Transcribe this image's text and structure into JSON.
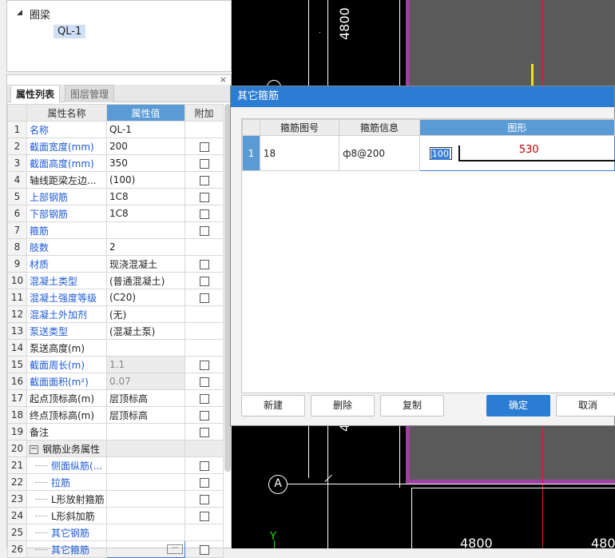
{
  "tree": {
    "root": "圈梁",
    "child": "QL-1"
  },
  "panel": {
    "tabs": [
      "属性列表",
      "图层管理"
    ],
    "headers": {
      "num": "",
      "name": "属性名称",
      "value": "属性值",
      "add": "附加"
    },
    "rows": [
      {
        "n": "1",
        "name": "名称",
        "value": "QL-1",
        "blue": true,
        "cb": false
      },
      {
        "n": "2",
        "name": "截面宽度(mm)",
        "value": "200",
        "blue": true,
        "cb": true
      },
      {
        "n": "3",
        "name": "截面高度(mm)",
        "value": "350",
        "blue": true,
        "cb": true
      },
      {
        "n": "4",
        "name": "轴线距梁左边...",
        "value": "(100)",
        "blue": false,
        "cb": true
      },
      {
        "n": "5",
        "name": "上部钢筋",
        "value": "1C8",
        "blue": true,
        "cb": true
      },
      {
        "n": "6",
        "name": "下部钢筋",
        "value": "1C8",
        "blue": true,
        "cb": true
      },
      {
        "n": "7",
        "name": "箍筋",
        "value": "",
        "blue": true,
        "cb": true
      },
      {
        "n": "8",
        "name": "肢数",
        "value": "2",
        "blue": true,
        "cb": false
      },
      {
        "n": "9",
        "name": "材质",
        "value": "现浇混凝土",
        "blue": true,
        "cb": true
      },
      {
        "n": "10",
        "name": "混凝土类型",
        "value": "(普通混凝土)",
        "blue": true,
        "cb": true
      },
      {
        "n": "11",
        "name": "混凝土强度等级",
        "value": "(C20)",
        "blue": true,
        "cb": true
      },
      {
        "n": "12",
        "name": "混凝土外加剂",
        "value": "(无)",
        "blue": true,
        "cb": false
      },
      {
        "n": "13",
        "name": "泵送类型",
        "value": "(混凝土泵)",
        "blue": true,
        "cb": false
      },
      {
        "n": "14",
        "name": "泵送高度(m)",
        "value": "",
        "blue": false,
        "cb": false
      },
      {
        "n": "15",
        "name": "截面周长(m)",
        "value": "1.1",
        "blue": true,
        "cb": true,
        "gray": true
      },
      {
        "n": "16",
        "name": "截面面积(m²)",
        "value": "0.07",
        "blue": true,
        "cb": true,
        "gray": true
      },
      {
        "n": "17",
        "name": "起点顶标高(m)",
        "value": "层顶标高",
        "blue": false,
        "cb": true
      },
      {
        "n": "18",
        "name": "终点顶标高(m)",
        "value": "层顶标高",
        "blue": false,
        "cb": true
      },
      {
        "n": "19",
        "name": "备注",
        "value": "",
        "blue": false,
        "cb": true
      },
      {
        "n": "20",
        "name": "钢筋业务属性",
        "value": "",
        "blue": false,
        "cb": false,
        "group": true
      },
      {
        "n": "21",
        "name": "侧面纵筋(...",
        "value": "",
        "blue": true,
        "cb": true,
        "sub": true
      },
      {
        "n": "22",
        "name": "拉筋",
        "value": "",
        "blue": true,
        "cb": true,
        "sub": true
      },
      {
        "n": "23",
        "name": "L形放射箍筋",
        "value": "",
        "blue": false,
        "cb": true,
        "sub": true
      },
      {
        "n": "24",
        "name": "L形斜加筋",
        "value": "",
        "blue": false,
        "cb": true,
        "sub": true
      },
      {
        "n": "25",
        "name": "其它钢筋",
        "value": "",
        "blue": true,
        "cb": false,
        "sub": true
      },
      {
        "n": "26",
        "name": "其它箍筋",
        "value": "",
        "blue": true,
        "cb": true,
        "sub": true,
        "editing": true
      }
    ]
  },
  "dialog": {
    "title": "其它箍筋",
    "headers": {
      "num": "",
      "shape_no": "箍筋图号",
      "info": "箍筋信息",
      "shape": "图形"
    },
    "row": {
      "n": "1",
      "shape_no": "18",
      "info": "ф8@200",
      "input": "100",
      "length": "530"
    },
    "buttons": {
      "new": "新建",
      "delete": "删除",
      "copy": "复制",
      "ok": "确定",
      "cancel": "取消"
    }
  },
  "cad": {
    "dim_top": "4800",
    "dim_bottom_left": "4800",
    "dim_bottom_right": "4800",
    "axis_a": "A",
    "axis_y": "Y",
    "partial_4": "4"
  }
}
